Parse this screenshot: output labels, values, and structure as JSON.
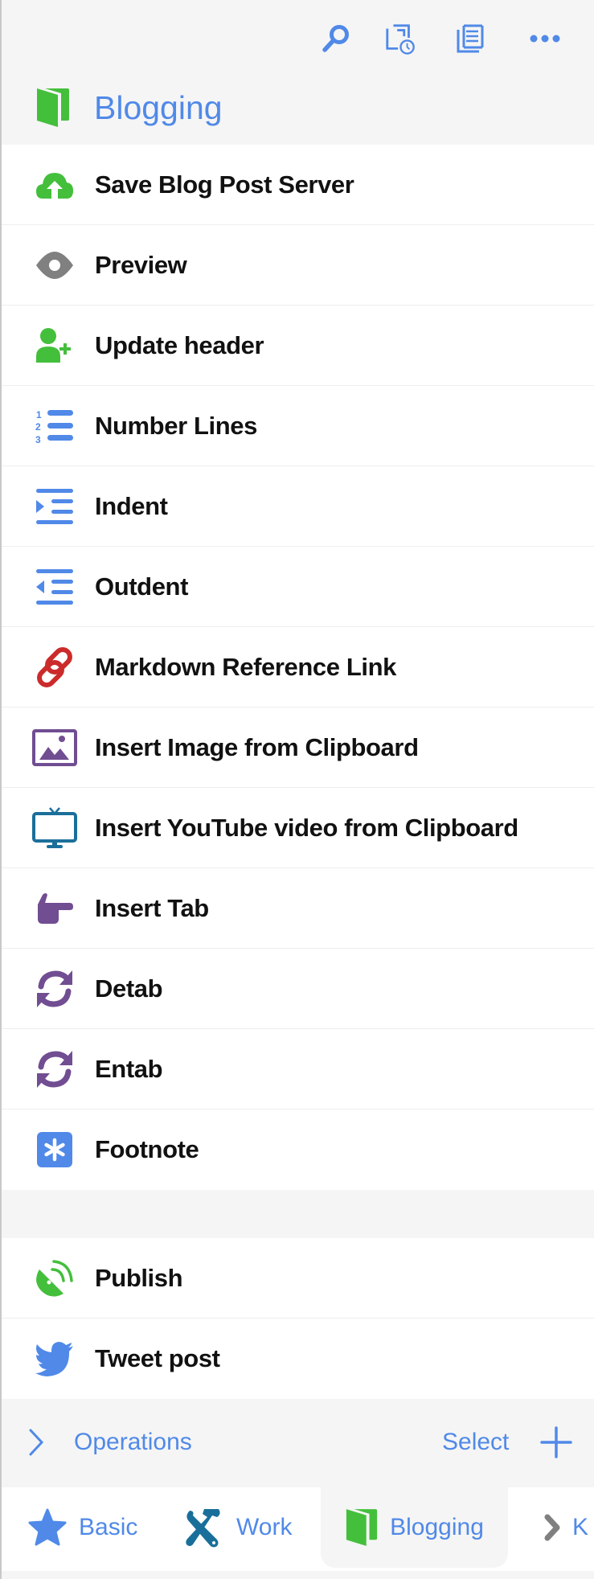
{
  "header": {
    "toolbar": [
      {
        "name": "search-icon",
        "label": "Search"
      },
      {
        "name": "history-icon",
        "label": "History"
      },
      {
        "name": "document-icon",
        "label": "Document"
      },
      {
        "name": "more-icon",
        "label": "More"
      }
    ],
    "title": "Blogging",
    "title_icon": "book-icon"
  },
  "actions": [
    {
      "label": "Save Blog Post Server",
      "icon": "cloud-upload-icon",
      "color": "#44bf3c"
    },
    {
      "label": "Preview",
      "icon": "eye-icon",
      "color": "#808080"
    },
    {
      "label": "Update header",
      "icon": "user-plus-icon",
      "color": "#44bf3c"
    },
    {
      "label": "Number Lines",
      "icon": "numbered-list-icon",
      "color": "#5089e8"
    },
    {
      "label": "Indent",
      "icon": "indent-icon",
      "color": "#5089e8"
    },
    {
      "label": "Outdent",
      "icon": "outdent-icon",
      "color": "#5089e8"
    },
    {
      "label": "Markdown Reference Link",
      "icon": "link-icon",
      "color": "#cc2b2b"
    },
    {
      "label": "Insert Image from Clipboard",
      "icon": "image-icon",
      "color": "#714d92"
    },
    {
      "label": "Insert YouTube video from Clipboard",
      "icon": "tv-icon",
      "color": "#1a6f9a"
    },
    {
      "label": "Insert Tab",
      "icon": "hand-pointing-icon",
      "color": "#714d92"
    },
    {
      "label": "Detab",
      "icon": "refresh-icon",
      "color": "#714d92"
    },
    {
      "label": "Entab",
      "icon": "refresh-icon",
      "color": "#714d92"
    },
    {
      "label": "Footnote",
      "icon": "asterisk-icon",
      "color": "#5089e8"
    }
  ],
  "actions2": [
    {
      "label": "Publish",
      "icon": "satellite-dish-icon",
      "color": "#44bf3c"
    },
    {
      "label": "Tweet post",
      "icon": "twitter-icon",
      "color": "#5089e8"
    }
  ],
  "operations": {
    "label": "Operations",
    "select_label": "Select",
    "add_icon": "plus-icon"
  },
  "tabs": [
    {
      "label": "Basic",
      "icon": "star-icon",
      "active": false
    },
    {
      "label": "Work",
      "icon": "tools-icon",
      "active": false
    },
    {
      "label": "Blogging",
      "icon": "book-icon",
      "active": true
    },
    {
      "label": "K",
      "icon": "chevron-right-icon",
      "active": false
    }
  ],
  "colors": {
    "accent": "#5089e8",
    "green": "#44bf3c",
    "purple": "#714d92",
    "background": "#f5f5f5"
  }
}
